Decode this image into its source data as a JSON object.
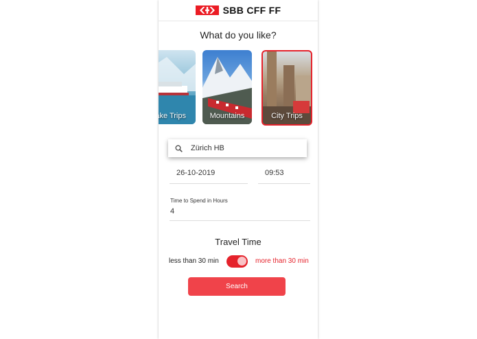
{
  "header": {
    "brand": "SBB CFF FF",
    "logo_icon": "sbb-logo-icon",
    "brand_color": "#eb1c24"
  },
  "question": "What do you like?",
  "categories": [
    {
      "label": "Lake Trips",
      "selected": false
    },
    {
      "label": "Mountains",
      "selected": false
    },
    {
      "label": "City Trips",
      "selected": true
    }
  ],
  "search": {
    "value": "Zürich HB",
    "icon": "search-icon"
  },
  "date": "26-10-2019",
  "time": "09:53",
  "hours": {
    "label": "Time to Spend in Hours",
    "value": "4"
  },
  "travel_time": {
    "title": "Travel Time",
    "less_label": "less than 30 min",
    "more_label": "more than 30 min",
    "toggle_on": true
  },
  "search_button": "Search",
  "accent_color": "#e5222b"
}
